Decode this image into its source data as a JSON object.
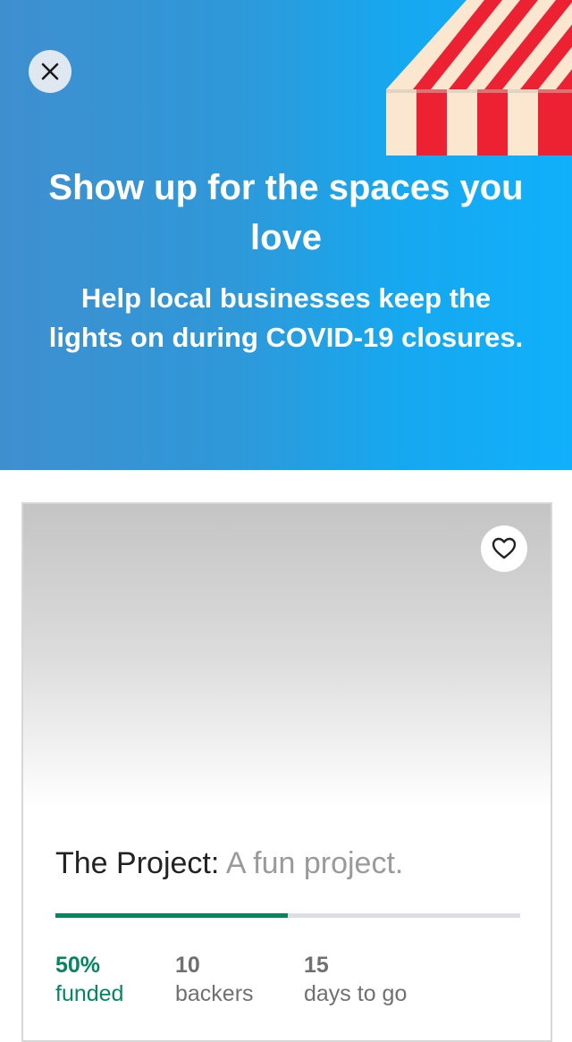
{
  "hero": {
    "title": "Show up for the spaces you love",
    "subtitle": "Help local businesses keep the lights on during COVID-19 closures.",
    "close_icon": "close-icon",
    "background_color": "#1fa0e6"
  },
  "project": {
    "name": "The Project:",
    "blurb": "A fun project.",
    "favorite_icon": "heart-icon",
    "funded_fraction": 0.5,
    "accent_color": "#05865f",
    "stats": {
      "funded_value": "50%",
      "funded_label": "funded",
      "backers_value": "10",
      "backers_label": "backers",
      "days_value": "15",
      "days_label": "days to go"
    }
  }
}
